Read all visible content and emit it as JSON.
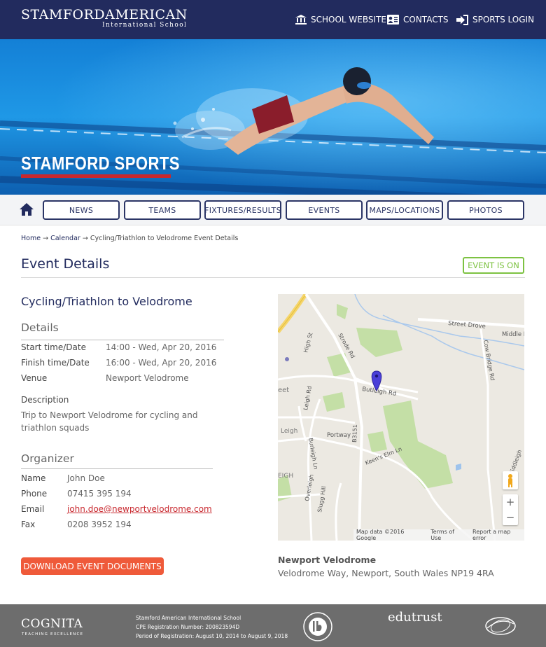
{
  "header": {
    "brand": "STAMFORDAMERICAN",
    "brand_sub": "International School",
    "links": [
      {
        "label": "SCHOOL WEBSITE",
        "icon": "school-icon"
      },
      {
        "label": "CONTACTS",
        "icon": "contacts-icon"
      },
      {
        "label": "SPORTS LOGIN",
        "icon": "login-icon"
      }
    ]
  },
  "hero": {
    "title": "STAMFORD SPORTS"
  },
  "nav": {
    "home_icon": "home-icon",
    "items": [
      "NEWS",
      "TEAMS",
      "FIXTURES/RESULTS",
      "EVENTS",
      "MAPS/LOCATIONS",
      "PHOTOS"
    ]
  },
  "breadcrumb": {
    "home": "Home",
    "arrow": "→",
    "calendar": "Calendar",
    "current": "Cycling/Triathlon to Velodrome Event Details"
  },
  "page": {
    "title": "Event Details",
    "status": "EVENT IS ON"
  },
  "event": {
    "name": "Cycling/Triathlon to Velodrome",
    "details_heading": "Details",
    "details": [
      {
        "label": "Start time/Date",
        "value": "14:00 - Wed, Apr 20, 2016"
      },
      {
        "label": "Finish time/Date",
        "value": "16:00 - Wed, Apr 20, 2016"
      },
      {
        "label": "Venue",
        "value": "Newport Velodrome"
      }
    ],
    "description_label": "Description",
    "description": "Trip to Newport Velodrome for cycling and triathlon squads",
    "organizer_heading": "Organizer",
    "organizer": [
      {
        "label": "Name",
        "value": "John Doe"
      },
      {
        "label": "Phone",
        "value": "07415 395 194"
      },
      {
        "label": "Email",
        "value": "john.doe@newportvelodrome.com"
      },
      {
        "label": "Fax",
        "value": "0208 3952 194"
      }
    ],
    "download_label": "DOWNLOAD EVENT DOCUMENTS"
  },
  "map": {
    "labels": [
      "Street Drove",
      "Middle D",
      "High St",
      "Strode Rd",
      "Cow Bridge Rd",
      "Butleigh Rd",
      "eet",
      "Leigh Rd",
      "Portway",
      "B3151",
      "Leigh",
      "Burleigh Ln",
      "Keen's Elm Ln",
      "Overleigh",
      "EIGH",
      "Slugg Hill",
      "Middleigh"
    ],
    "footer": [
      "Map data ©2016 Google",
      "Terms of Use",
      "Report a map error"
    ],
    "zoom_in": "+",
    "zoom_out": "−"
  },
  "venue": {
    "name": "Newport Velodrome",
    "address": "Velodrome Way, Newport, South Wales NP19 4RA"
  },
  "footer": {
    "cognita": "COGNITA",
    "cognita_sub": "TEACHING EXCELLENCE",
    "lines": [
      "Stamford American International School",
      "CPE Registration Number: 200823594D",
      "Period of Registration: August 10, 2014 to August 9, 2018"
    ],
    "logos": [
      "ib-world-school-logo",
      "edutrust-logo",
      "council-of-international-schools-logo"
    ],
    "edutrust": "edutrust"
  },
  "colors": {
    "navy": "#222b5e",
    "red": "#c8282e",
    "green": "#7dc242",
    "orange": "#ef5a3a",
    "footer": "#6d6d6d"
  }
}
